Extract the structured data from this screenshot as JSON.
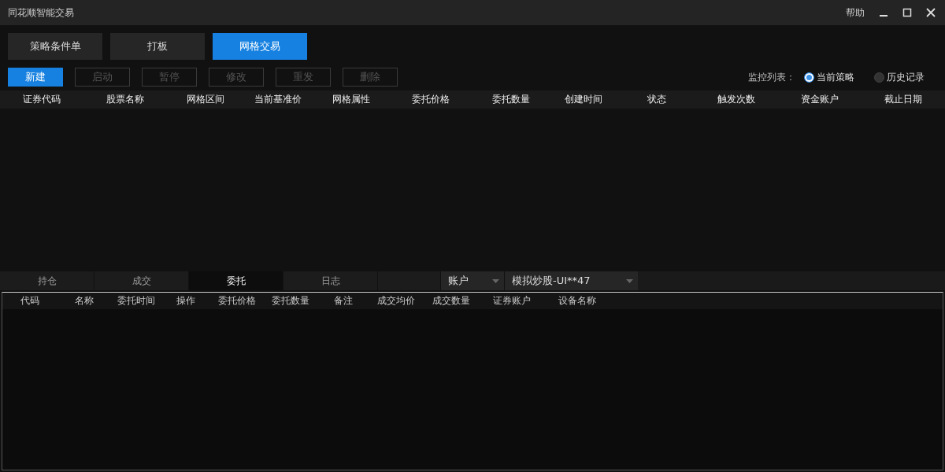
{
  "window": {
    "title": "同花顺智能交易",
    "help": "帮助"
  },
  "strategy_tabs": [
    {
      "label": "策略条件单",
      "selected": false
    },
    {
      "label": "打板",
      "selected": false
    },
    {
      "label": "网格交易",
      "selected": true
    }
  ],
  "toolbar": [
    {
      "label": "新建",
      "disabled": false
    },
    {
      "label": "启动",
      "disabled": true
    },
    {
      "label": "暂停",
      "disabled": true
    },
    {
      "label": "修改",
      "disabled": true
    },
    {
      "label": "重发",
      "disabled": true
    },
    {
      "label": "删除",
      "disabled": true
    }
  ],
  "monitor": {
    "label": "监控列表：",
    "options": [
      {
        "label": "当前策略",
        "selected": true
      },
      {
        "label": "历史记录",
        "selected": false
      }
    ]
  },
  "strategy_table": {
    "columns": [
      "证券代码",
      "股票名称",
      "网格区间",
      "当前基准价",
      "网格属性",
      "委托价格",
      "委托数量",
      "创建时间",
      "状态",
      "触发次数",
      "资金账户",
      "截止日期"
    ]
  },
  "bottom_tabs": [
    {
      "label": "持仓",
      "selected": false
    },
    {
      "label": "成交",
      "selected": false
    },
    {
      "label": "委托",
      "selected": true
    },
    {
      "label": "日志",
      "selected": false
    }
  ],
  "account_label": "账户",
  "account_value": "模拟炒股-UI**47",
  "orders_table": {
    "columns": [
      "代码",
      "名称",
      "委托时间",
      "操作",
      "委托价格",
      "委托数量",
      "备注",
      "成交均价",
      "成交数量",
      "证券账户",
      "设备名称"
    ]
  }
}
